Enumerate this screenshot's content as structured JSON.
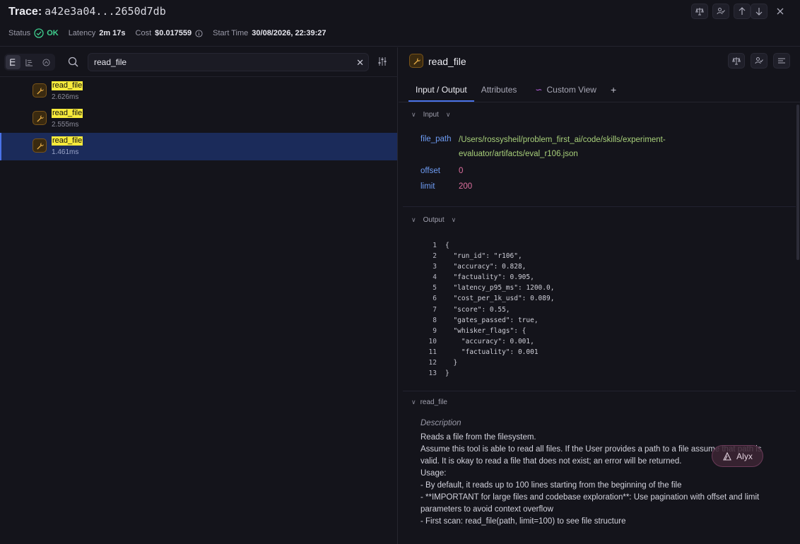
{
  "header": {
    "title_label": "Trace:",
    "trace_id": "a42e3a04...2650d7db",
    "status_label": "Status",
    "status_value": "OK",
    "latency_label": "Latency",
    "latency_value": "2m 17s",
    "cost_label": "Cost",
    "cost_value": "$0.017559",
    "start_time_label": "Start Time",
    "start_time_value": "30/08/2026, 22:39:27"
  },
  "search": {
    "value": "read_file"
  },
  "spans": [
    {
      "name": "read_file",
      "duration": "2.626ms"
    },
    {
      "name": "read_file",
      "duration": "2.555ms"
    },
    {
      "name": "read_file",
      "duration": "1.461ms"
    }
  ],
  "detail": {
    "name": "read_file",
    "tabs": [
      "Input / Output",
      "Attributes",
      "Custom View",
      "+"
    ],
    "input_label": "Input",
    "input": {
      "file_path_key": "file_path",
      "file_path_line1": "/Users/rossysheil/problem_first_ai/code/skills/experiment-",
      "file_path_line2": "evaluator/artifacts/eval_r106.json",
      "offset_key": "offset",
      "offset_value": "0",
      "limit_key": "limit",
      "limit_value": "200"
    },
    "output_label": "Output",
    "output_lines": [
      {
        "n": "1",
        "t": "{"
      },
      {
        "n": "2",
        "t": "  \"run_id\": \"r106\","
      },
      {
        "n": "3",
        "t": "  \"accuracy\": 0.828,"
      },
      {
        "n": "4",
        "t": "  \"factuality\": 0.905,"
      },
      {
        "n": "5",
        "t": "  \"latency_p95_ms\": 1200.0,"
      },
      {
        "n": "6",
        "t": "  \"cost_per_1k_usd\": 0.089,"
      },
      {
        "n": "7",
        "t": "  \"score\": 0.55,"
      },
      {
        "n": "8",
        "t": "  \"gates_passed\": true,"
      },
      {
        "n": "9",
        "t": "  \"whisker_flags\": {"
      },
      {
        "n": "10",
        "t": "    \"accuracy\": 0.001,"
      },
      {
        "n": "11",
        "t": "    \"factuality\": 0.001"
      },
      {
        "n": "12",
        "t": "  }"
      },
      {
        "n": "13",
        "t": "}"
      }
    ],
    "tool_section_label": "read_file",
    "description_title": "Description",
    "description_lines": [
      "Reads a file from the filesystem.",
      "",
      "Assume this tool is able to read all files. If the User provides a path to a file assume that path is valid. It is okay to read a file that does not exist; an error will be returned.",
      "",
      "Usage:",
      "- By default, it reads up to 100 lines starting from the beginning of the file",
      "- **IMPORTANT for large files and codebase exploration**: Use pagination with offset and limit parameters to avoid context overflow",
      "- First scan: read_file(path, limit=100) to see file structure"
    ]
  },
  "assistant": {
    "label": "Alyx"
  },
  "colors": {
    "accent": "#4a72e8",
    "ok": "#3fcf8e",
    "highlight": "#f7ea3b",
    "tool": "#f0b44a"
  }
}
